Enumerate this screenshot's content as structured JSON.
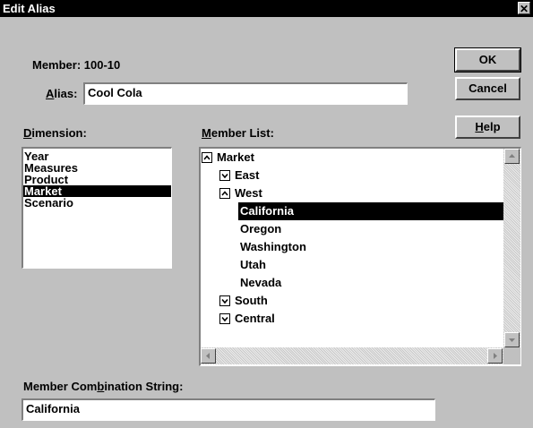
{
  "window": {
    "title": "Edit Alias",
    "close_glyph": "✕"
  },
  "member": {
    "label": "Member: 100-10"
  },
  "alias": {
    "label_prefix": "",
    "label_underline": "A",
    "label_rest": "lias:",
    "value": "Cool Cola"
  },
  "buttons": {
    "ok": "OK",
    "cancel": "Cancel",
    "help_underline": "H",
    "help_rest": "elp"
  },
  "dimension": {
    "label_underline": "D",
    "label_rest": "imension:",
    "items": [
      "Year",
      "Measures",
      "Product",
      "Market",
      "Scenario"
    ],
    "selected": "Market"
  },
  "member_list": {
    "label_underline": "M",
    "label_rest": "ember List:",
    "items": [
      {
        "label": "Market",
        "icon": "collapse-icon"
      },
      {
        "label": "East",
        "icon": "expand-icon"
      },
      {
        "label": "West",
        "icon": "collapse-icon"
      },
      {
        "label": "California",
        "icon": "",
        "selected": true
      },
      {
        "label": "Oregon",
        "icon": ""
      },
      {
        "label": "Washington",
        "icon": ""
      },
      {
        "label": "Utah",
        "icon": ""
      },
      {
        "label": "Nevada",
        "icon": ""
      },
      {
        "label": "South",
        "icon": "expand-icon"
      },
      {
        "label": "Central",
        "icon": "expand-icon"
      }
    ]
  },
  "combination": {
    "label_prefix": "Member Com",
    "label_underline": "b",
    "label_rest": "ination String:",
    "value": "California"
  }
}
